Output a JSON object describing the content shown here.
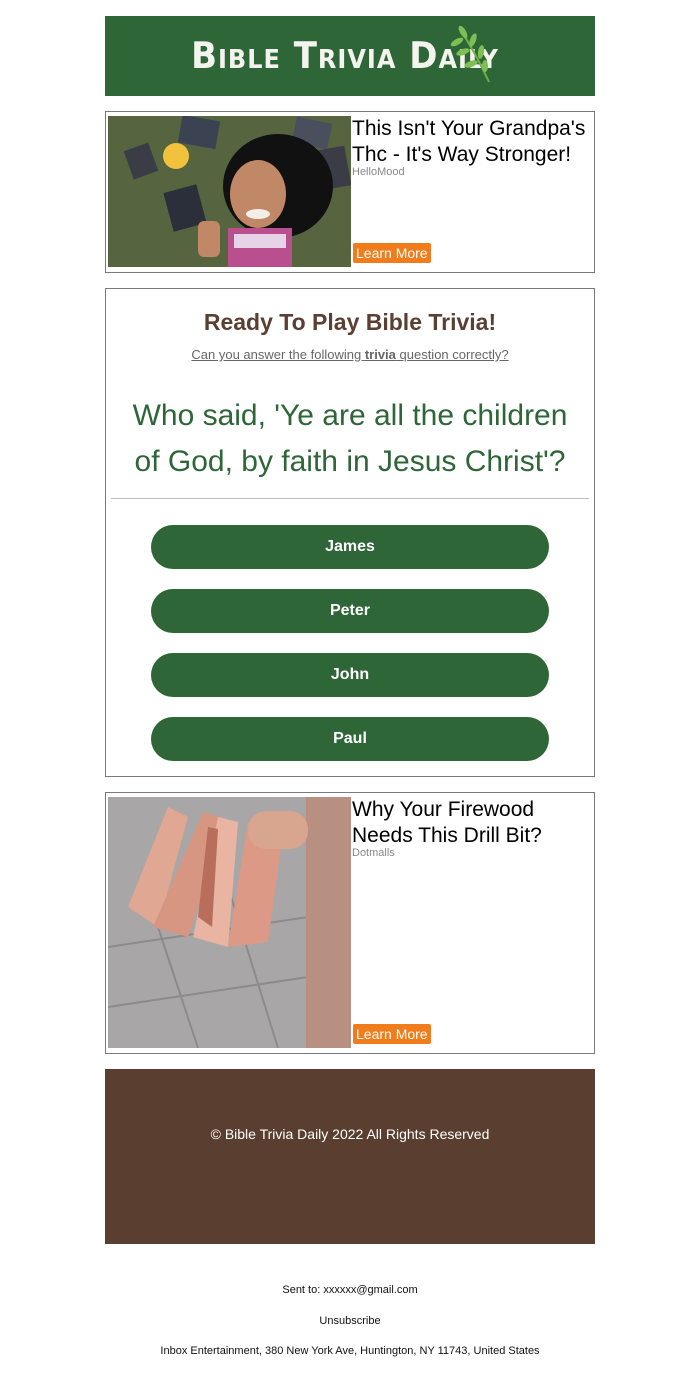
{
  "header": {
    "logo_text": "Bible Trivia Daily"
  },
  "ad1": {
    "title": "This Isn't Your Grandpa's Thc - It's Way Stronger!",
    "source": "HelloMood",
    "button": "Learn More"
  },
  "trivia": {
    "heading": "Ready To Play Bible Trivia!",
    "sub_before": "Can you answer the following ",
    "sub_bold": "trivia",
    "sub_after": " question correctly?",
    "question": "Who said, 'Ye are all the children of God, by faith in Jesus Christ'?",
    "answers": [
      "James",
      "Peter",
      "John",
      "Paul"
    ]
  },
  "ad2": {
    "title": "Why Your Firewood Needs This Drill Bit?",
    "source": "Dotmalls",
    "button": "Learn More"
  },
  "footer": {
    "copyright": "© Bible Trivia Daily 2022 All Rights Reserved",
    "sent_to": "Sent to: xxxxxx@gmail.com",
    "unsubscribe": "Unsubscribe",
    "address": "Inbox Entertainment, 380 New York Ave, Huntington, NY 11743, United States"
  },
  "colors": {
    "brand_green": "#2e6638",
    "heading_brown": "#5a3f32",
    "footer_brown": "#5a3f30",
    "cta_orange": "#f07c1c"
  }
}
